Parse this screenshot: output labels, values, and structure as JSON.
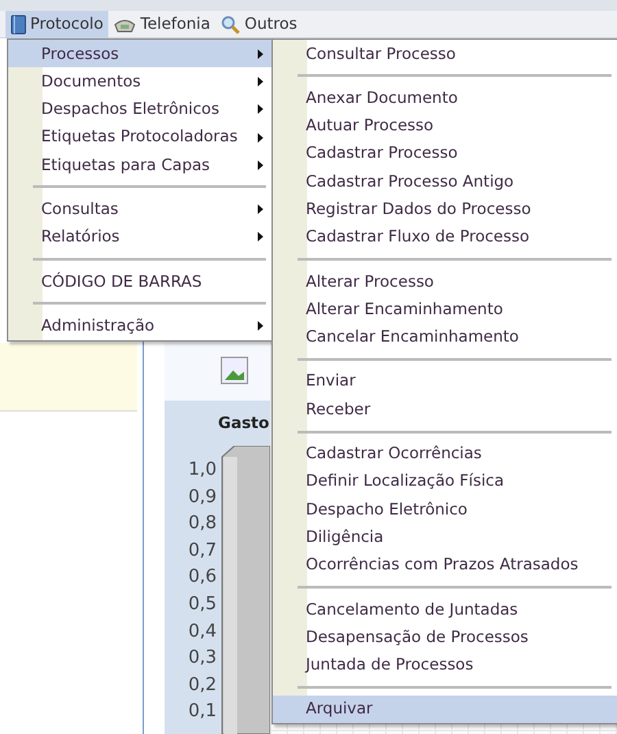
{
  "menubar": [
    {
      "label": "Protocolo",
      "selected": true
    },
    {
      "label": "Telefonia",
      "selected": false
    },
    {
      "label": "Outros",
      "selected": false
    }
  ],
  "menu": [
    {
      "kind": "item",
      "label": "Processos",
      "submenu": true,
      "selected": true
    },
    {
      "kind": "item",
      "label": "Documentos",
      "submenu": true,
      "selected": false
    },
    {
      "kind": "item",
      "label": "Despachos Eletrônicos",
      "submenu": true,
      "selected": false
    },
    {
      "kind": "item",
      "label": "Etiquetas Protocoladoras",
      "submenu": true,
      "selected": false
    },
    {
      "kind": "item",
      "label": "Etiquetas para Capas",
      "submenu": true,
      "selected": false
    },
    {
      "kind": "separator"
    },
    {
      "kind": "item",
      "label": "Consultas",
      "submenu": true,
      "selected": false
    },
    {
      "kind": "item",
      "label": "Relatórios",
      "submenu": true,
      "selected": false
    },
    {
      "kind": "separator"
    },
    {
      "kind": "item",
      "label": "CÓDIGO DE BARRAS",
      "submenu": false,
      "selected": false
    },
    {
      "kind": "separator"
    },
    {
      "kind": "item",
      "label": "Administração",
      "submenu": true,
      "selected": false
    }
  ],
  "submenu": [
    {
      "kind": "item",
      "label": "Consultar Processo",
      "selected": false
    },
    {
      "kind": "separator"
    },
    {
      "kind": "item",
      "label": "Anexar Documento",
      "selected": false
    },
    {
      "kind": "item",
      "label": "Autuar Processo",
      "selected": false
    },
    {
      "kind": "item",
      "label": "Cadastrar Processo",
      "selected": false
    },
    {
      "kind": "item",
      "label": "Cadastrar Processo Antigo",
      "selected": false
    },
    {
      "kind": "item",
      "label": "Registrar Dados do Processo",
      "selected": false
    },
    {
      "kind": "item",
      "label": "Cadastrar Fluxo de Processo",
      "selected": false
    },
    {
      "kind": "separator"
    },
    {
      "kind": "item",
      "label": "Alterar Processo",
      "selected": false
    },
    {
      "kind": "item",
      "label": "Alterar Encaminhamento",
      "selected": false
    },
    {
      "kind": "item",
      "label": "Cancelar Encaminhamento",
      "selected": false
    },
    {
      "kind": "separator"
    },
    {
      "kind": "item",
      "label": "Enviar",
      "selected": false
    },
    {
      "kind": "item",
      "label": "Receber",
      "selected": false
    },
    {
      "kind": "separator"
    },
    {
      "kind": "item",
      "label": "Cadastrar Ocorrências",
      "selected": false
    },
    {
      "kind": "item",
      "label": "Definir Localização Física",
      "selected": false
    },
    {
      "kind": "item",
      "label": "Despacho Eletrônico",
      "selected": false
    },
    {
      "kind": "item",
      "label": "Diligência",
      "selected": false
    },
    {
      "kind": "item",
      "label": "Ocorrências com Prazos Atrasados",
      "selected": false
    },
    {
      "kind": "separator"
    },
    {
      "kind": "item",
      "label": "Cancelamento de Juntadas",
      "selected": false
    },
    {
      "kind": "item",
      "label": "Desapensação de Processos",
      "selected": false
    },
    {
      "kind": "item",
      "label": "Juntada de Processos",
      "selected": false
    },
    {
      "kind": "separator"
    },
    {
      "kind": "item",
      "label": "Arquivar",
      "selected": true
    }
  ],
  "chart": {
    "title": "Gasto",
    "axis_labels": [
      "1,0",
      "0,9",
      "0,8",
      "0,7",
      "0,6",
      "0,5",
      "0,4",
      "0,3",
      "0,2",
      "0,1"
    ]
  }
}
